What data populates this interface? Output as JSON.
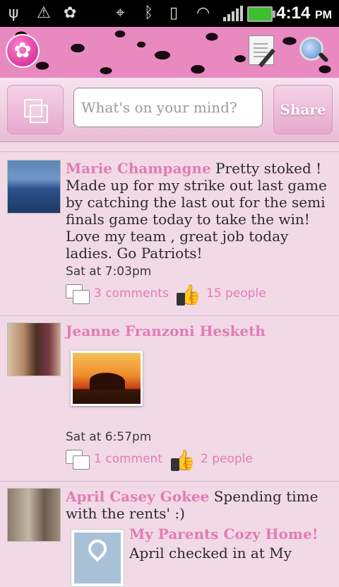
{
  "status_bar": {
    "time": "4:14",
    "ampm": "PM"
  },
  "composer": {
    "placeholder": "What's on your mind?",
    "share_label": "Share"
  },
  "posts": [
    {
      "author": "Marie Champagne",
      "body": " Pretty stoked ! Made up for my strike out last game by catching the last out for the semi finals game today to take the win! Love my team , great job today ladies. Go Patriots!",
      "time": "Sat at 7:03pm",
      "comments": "3 comments",
      "likes": "15 people"
    },
    {
      "author": "Jeanne Franzoni Hesketh",
      "body": "",
      "time": "Sat at 6:57pm",
      "comments": "1 comment",
      "likes": "2 people"
    },
    {
      "author": "April Casey Gokee",
      "body": " Spending time with the rents' :)",
      "place_title": "My Parents Cozy Home!",
      "place_sub": "April checked in at My"
    }
  ],
  "colors": {
    "accent": "#e07cb6",
    "background": "#f2d9e6"
  }
}
